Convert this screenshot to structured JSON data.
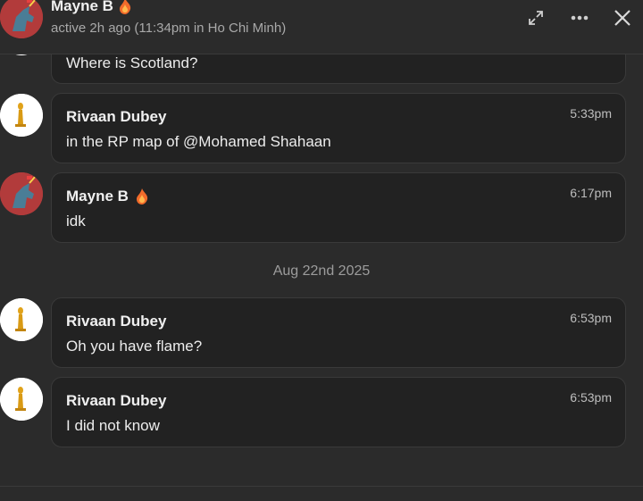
{
  "header": {
    "name": "Mayne B",
    "status": "active 2h ago (11:34pm in Ho Chi Minh)",
    "icons": [
      "expand-icon",
      "more-icon",
      "close-icon"
    ]
  },
  "messages": [
    {
      "sender": "",
      "time": "",
      "text": "Where is Scotland?"
    },
    {
      "sender": "Rivaan Dubey",
      "time": "5:33pm",
      "text": "in the RP map of @Mohamed Shahaan"
    },
    {
      "sender": "Mayne B",
      "time": "6:17pm",
      "text": "idk"
    },
    {
      "sender": "Rivaan Dubey",
      "time": "6:53pm",
      "text": "Oh you have flame?"
    },
    {
      "sender": "Rivaan Dubey",
      "time": "6:53pm",
      "text": "I did not know"
    }
  ],
  "date_separator": "Aug 22nd 2025",
  "colors": {
    "background": "#2b2b2b",
    "bubble": "#222222",
    "flame": "#f26b2b",
    "mayne_avatar": "#b23b3b"
  }
}
